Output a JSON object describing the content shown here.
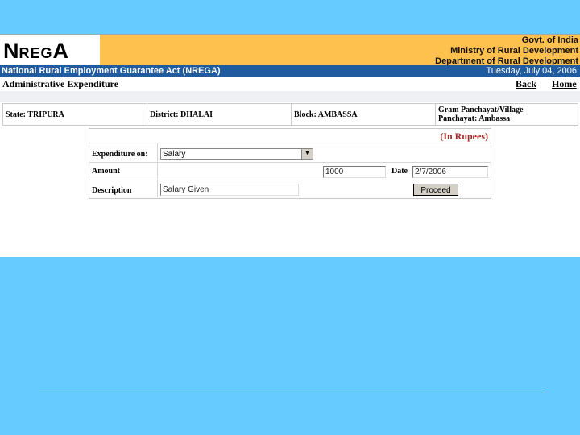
{
  "header": {
    "logo_n": "N",
    "logo_reg": "REG",
    "logo_a": "A",
    "govt_lines": [
      "Govt. of India",
      "Ministry of Rural Development",
      "Department of Rural Development"
    ],
    "act_title": "National Rural Employment Guarantee Act (NREGA)",
    "date": "Tuesday, July 04, 2006"
  },
  "subheader": {
    "page_title": "Administrative Expenditure",
    "back_label": "Back",
    "home_label": "Home"
  },
  "location": {
    "state": "State: TRIPURA",
    "district": "District: DHALAI",
    "block": "Block: AMBASSA",
    "gp_line1": "Gram Panchayat/Village",
    "gp_line2": "Panchayat: Ambassa"
  },
  "form": {
    "units_note": "(In Rupees)",
    "expenditure_label": "Expenditure on:",
    "expenditure_value": "Salary",
    "amount_label": "Amount",
    "amount_value": "1000",
    "date_label": "Date",
    "date_value": "2/7/2006",
    "description_label": "Description",
    "description_value": "Salary Given",
    "proceed_label": "Proceed"
  },
  "colors": {
    "page_background": "#66ccff",
    "banner": "#ffc14d",
    "title_bar": "#1f5b9e",
    "units_note": "#a52a2a"
  }
}
